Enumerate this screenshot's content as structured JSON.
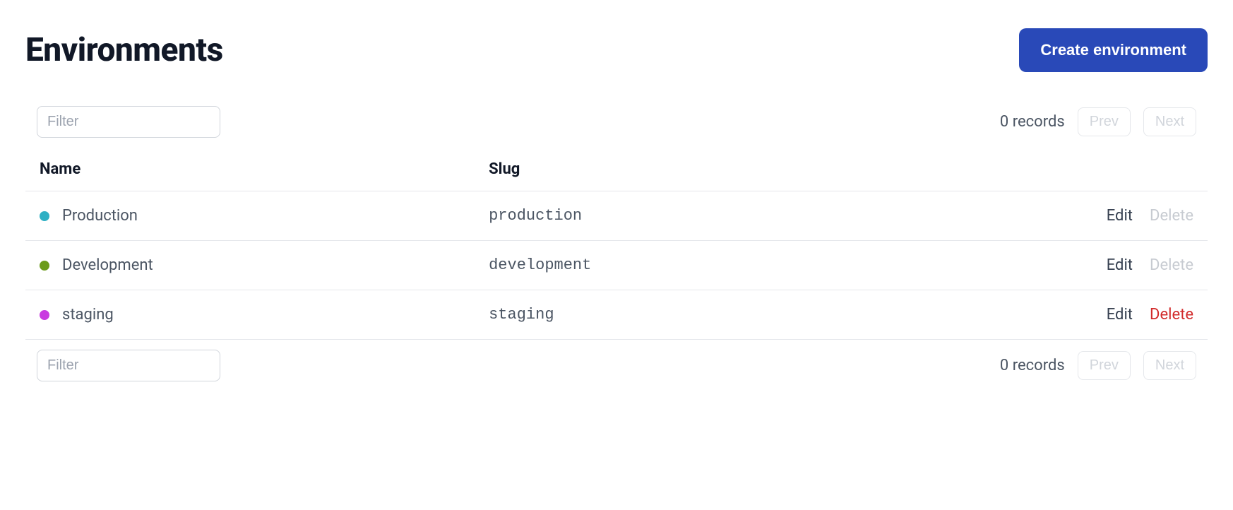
{
  "header": {
    "title": "Environments",
    "create_button": "Create environment"
  },
  "filter": {
    "placeholder": "Filter"
  },
  "pagination": {
    "records_text": "0 records",
    "prev_label": "Prev",
    "next_label": "Next"
  },
  "table": {
    "columns": {
      "name": "Name",
      "slug": "Slug"
    },
    "rows": [
      {
        "name": "Production",
        "slug": "production",
        "color": "#2fb0c4",
        "edit_label": "Edit",
        "delete_label": "Delete",
        "delete_enabled": false
      },
      {
        "name": "Development",
        "slug": "development",
        "color": "#6b9b1a",
        "edit_label": "Edit",
        "delete_label": "Delete",
        "delete_enabled": false
      },
      {
        "name": "staging",
        "slug": "staging",
        "color": "#c93ae0",
        "edit_label": "Edit",
        "delete_label": "Delete",
        "delete_enabled": true
      }
    ]
  }
}
